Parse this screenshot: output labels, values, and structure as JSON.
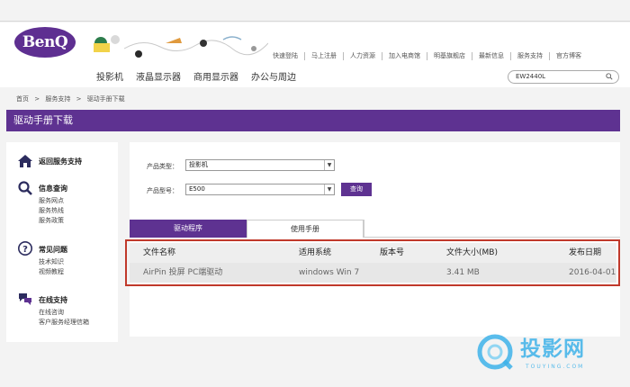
{
  "header": {
    "logo_text": "BenQ",
    "main_nav": [
      "投影机",
      "液晶显示器",
      "商用显示器",
      "办公与周边"
    ],
    "top_links": [
      "快速登陆",
      "马上注册",
      "人力资源",
      "加入电商馆",
      "明基旗舰店",
      "最新信息",
      "服务支持",
      "官方博客"
    ],
    "search_value": "EW2440L"
  },
  "breadcrumb": [
    "首页",
    ">",
    "服务支持",
    ">",
    "驱动手册下载"
  ],
  "page_title": "驱动手册下载",
  "sidebar": {
    "return": {
      "title": "返回服务支持",
      "icon": "home-icon"
    },
    "info": {
      "title": "信息查询",
      "icon": "search-icon",
      "items": [
        "服务网点",
        "服务热线",
        "服务政策"
      ]
    },
    "faq": {
      "title": "常见问题",
      "icon": "question-icon",
      "items": [
        "技术知识",
        "视频教程"
      ]
    },
    "online": {
      "title": "在线支持",
      "icon": "chat-icon",
      "items": [
        "在线咨询",
        "客户服务经理信箱"
      ]
    }
  },
  "form": {
    "type_label": "产品类型：",
    "type_value": "投影机",
    "model_label": "产品型号：",
    "model_value": "E500",
    "query_button": "查询"
  },
  "tabs": [
    "驱动程序",
    "使用手册"
  ],
  "table": {
    "headers": [
      "文件名称",
      "适用系统",
      "版本号",
      "文件大小(MB)",
      "发布日期"
    ],
    "rows": [
      [
        "AirPin 投屏 PC端驱动",
        "windows Win 7",
        "",
        "3.41 MB",
        "2016-04-01"
      ]
    ]
  },
  "watermark": {
    "text": "投影网",
    "sub": "TOUYING.COM"
  },
  "colors": {
    "brand": "#5e3291",
    "highlight_box": "#c0392b",
    "watermark": "#3db2e9"
  }
}
